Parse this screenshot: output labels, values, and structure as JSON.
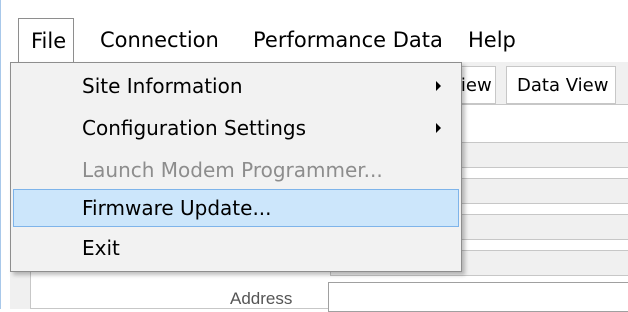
{
  "menubar": {
    "file": "File",
    "connection": "Connection",
    "performance_data": "Performance Data",
    "help": "Help"
  },
  "file_menu": {
    "items": [
      {
        "label": "Site Information",
        "submenu": true,
        "enabled": true
      },
      {
        "label": "Configuration Settings",
        "submenu": true,
        "enabled": true
      },
      {
        "label": "Launch Modem Programmer...",
        "submenu": false,
        "enabled": false
      },
      {
        "label": "Firmware Update...",
        "submenu": false,
        "enabled": true,
        "highlighted": true
      },
      {
        "label": "Exit",
        "submenu": false,
        "enabled": true
      }
    ]
  },
  "tabs": {
    "partial_view": "View",
    "data_view": "Data View"
  },
  "form": {
    "address_label": "Address"
  },
  "colors": {
    "highlight_bg": "#cce6fb",
    "highlight_border": "#7eb4ea",
    "disabled_text": "#8d8d8d"
  }
}
